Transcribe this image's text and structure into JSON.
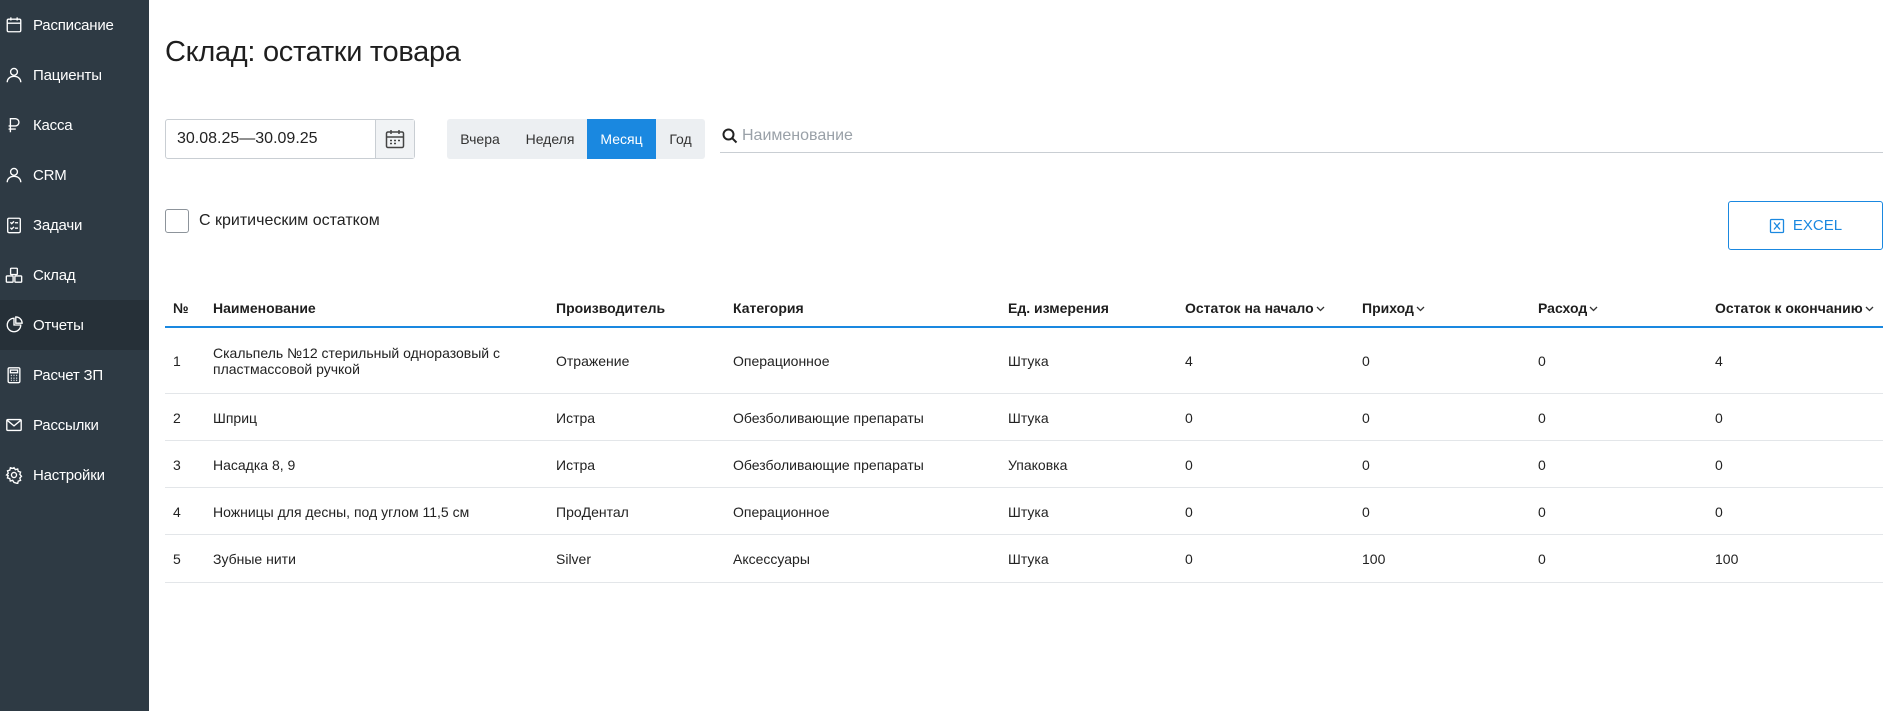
{
  "sidebar": {
    "items": [
      {
        "label": "Расписание",
        "icon": "calendar-icon"
      },
      {
        "label": "Пациенты",
        "icon": "user-icon"
      },
      {
        "label": "Касса",
        "icon": "ruble-icon"
      },
      {
        "label": "CRM",
        "icon": "user-icon"
      },
      {
        "label": "Задачи",
        "icon": "tasks-icon"
      },
      {
        "label": "Склад",
        "icon": "boxes-icon"
      },
      {
        "label": "Отчеты",
        "icon": "pie-chart-icon"
      },
      {
        "label": "Расчет ЗП",
        "icon": "calculator-icon"
      },
      {
        "label": "Рассылки",
        "icon": "mail-icon"
      },
      {
        "label": "Настройки",
        "icon": "gear-icon"
      }
    ],
    "active_index": 6
  },
  "page": {
    "title": "Склад: остатки товара"
  },
  "filters": {
    "date_range": "30.08.25—30.09.25",
    "periods": [
      "Вчера",
      "Неделя",
      "Месяц",
      "Год"
    ],
    "active_period": "Месяц",
    "search_placeholder": "Наименование",
    "search_value": "",
    "critical_label": "С критическим остатком",
    "critical_checked": false,
    "excel_label": "EXCEL"
  },
  "table": {
    "columns": [
      "№",
      "Наименование",
      "Производитель",
      "Категория",
      "Ед. измерения",
      "Остаток на начало",
      "Приход",
      "Расход",
      "Остаток к окончанию"
    ],
    "sortable": [
      false,
      false,
      false,
      false,
      false,
      true,
      true,
      true,
      true
    ],
    "rows": [
      {
        "n": "1",
        "name": "Скальпель №12 стерильный одноразовый с пластмассовой ручкой",
        "maker": "Отражение",
        "category": "Операционное",
        "unit": "Штука",
        "start": "4",
        "income": "0",
        "expense": "0",
        "end": "4"
      },
      {
        "n": "2",
        "name": "Шприц",
        "maker": "Истра",
        "category": "Обезболивающие препараты",
        "unit": "Штука",
        "start": "0",
        "income": "0",
        "expense": "0",
        "end": "0"
      },
      {
        "n": "3",
        "name": "Насадка 8, 9",
        "maker": "Истра",
        "category": "Обезболивающие препараты",
        "unit": "Упаковка",
        "start": "0",
        "income": "0",
        "expense": "0",
        "end": "0"
      },
      {
        "n": "4",
        "name": "Ножницы для десны, под углом 11,5 см",
        "maker": "ПроДентал",
        "category": "Операционное",
        "unit": "Штука",
        "start": "0",
        "income": "0",
        "expense": "0",
        "end": "0"
      },
      {
        "n": "5",
        "name": "Зубные нити",
        "maker": "Silver",
        "category": "Аксессуары",
        "unit": "Штука",
        "start": "0",
        "income": "100",
        "expense": "0",
        "end": "100"
      }
    ]
  },
  "colors": {
    "sidebar_bg": "#2e3a44",
    "accent": "#1a88e0",
    "period_bg": "#eceff2"
  }
}
